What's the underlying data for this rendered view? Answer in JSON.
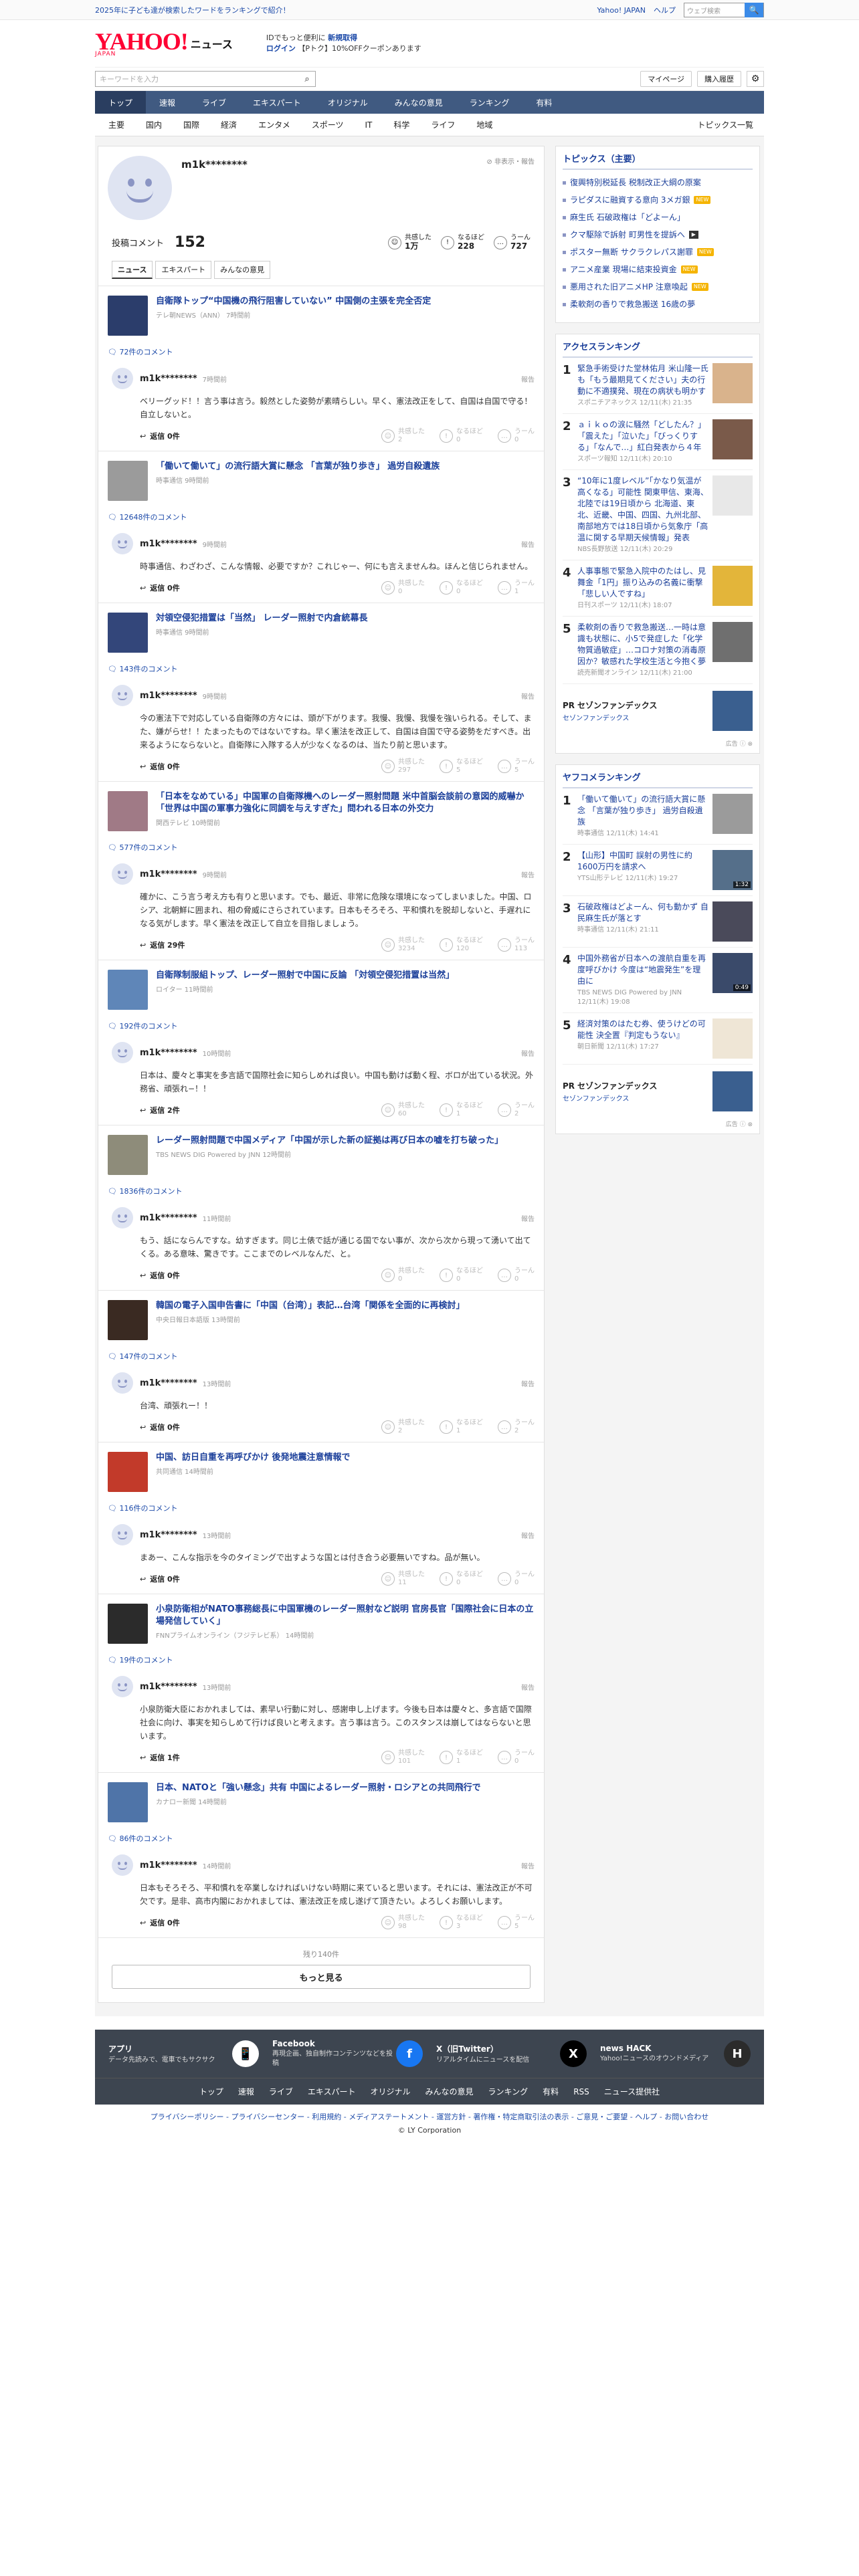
{
  "promo": {
    "text": "2025年に子ども達が検索したワードをランキングで紹介！",
    "yahoo_japan": "Yahoo! JAPAN",
    "help": "ヘルプ",
    "search_placeholder": "ウェブ検索",
    "search_btn": "🔍"
  },
  "masthead": {
    "logo": "YAHOO!",
    "logo_sub": "JAPAN",
    "news": "ニュース",
    "login_line1": "IDでもっと便利に",
    "login_line1_link": "新規取得",
    "login_line2_link": "ログイン",
    "login_line2_text": "【Pトク】10%OFFクーポンあります"
  },
  "search": {
    "placeholder": "キーワードを入力",
    "mypage": "マイページ",
    "history": "購入履歴"
  },
  "nav": [
    "トップ",
    "速報",
    "ライブ",
    "エキスパート",
    "オリジナル",
    "みんなの意見",
    "ランキング",
    "有料"
  ],
  "subnav": [
    "主要",
    "国内",
    "国際",
    "経済",
    "エンタメ",
    "スポーツ",
    "IT",
    "科学",
    "ライフ",
    "地域"
  ],
  "subnav_topics": "トピックス一覧",
  "profile": {
    "name": "m1k********",
    "report": "非表示・報告",
    "comment_label": "投稿コメント",
    "comment_count": "152",
    "reactions": [
      {
        "icon": "☺",
        "label": "共感した",
        "value": "1万"
      },
      {
        "icon": "!",
        "label": "なるほど",
        "value": "228"
      },
      {
        "icon": "…",
        "label": "うーん",
        "value": "727"
      }
    ],
    "tabs": [
      "ニュース",
      "エキスパート",
      "みんなの意見"
    ]
  },
  "entries": [
    {
      "title": "自衛隊トップ“中国機の飛行阻害していない” 中国側の主張を完全否定",
      "source": "テレ朝NEWS（ANN） 7時間前",
      "thumb": "#2b3d6b",
      "count": "72件のコメント",
      "time": "7時間前",
      "body": "ベリーグッド！！言う事は言う。毅然とした姿勢が素晴らしい。早く、憲法改正をして、自国は自国で守る！自立しないと。",
      "reply": "返信 0件",
      "votes": [
        "2",
        "0",
        "0"
      ]
    },
    {
      "title": "「働いて働いて」の流行語大賞に懸念 「言葉が独り歩き」 過労自殺遺族",
      "source": "時事通信 9時間前",
      "thumb": "#9b9b9b",
      "count": "12648件のコメント",
      "time": "9時間前",
      "body": "時事通信、わざわざ、こんな情報、必要ですか？これじゃー、何にも言えませんね。ほんと信じられません。",
      "reply": "返信 0件",
      "votes": [
        "0",
        "0",
        "1"
      ]
    },
    {
      "title": "対領空侵犯措置は「当然」 レーダー照射で内倉統幕長",
      "source": "時事通信 9時間前",
      "thumb": "#33467a",
      "count": "143件のコメント",
      "time": "9時間前",
      "body": "今の憲法下で対応している自衛隊の方々には、頭が下がります。我慢、我慢、我慢を強いられる。そして、また、嫌がらせ！！たまったものではないですね。早く憲法を改正して、自国は自国で守る姿勢をだすべき。出来るようにならないと。自衛隊に入隊する人が少なくなるのは、当たり前と思います。",
      "reply": "返信 0件",
      "votes": [
        "297",
        "5",
        "5"
      ]
    },
    {
      "title": "「日本をなめている」中国軍の自衛隊機へのレーダー照射問題 米中首脳会談前の意図的威嚇か「世界は中国の軍事力強化に同調を与えすぎた」問われる日本の外交力",
      "source": "関西テレビ 10時間前",
      "thumb": "#a07a86",
      "count": "577件のコメント",
      "time": "9時間前",
      "body": "確かに、こう言う考え方も有りと思います。でも、最近、非常に危険な環境になってしまいました。中国、ロシア、北朝鮮に囲まれ、相の脅威にさらされています。日本もそろそろ、平和慣れを脱却しないと、手遅れになる気がします。早く憲法を改正して自立を目指しましょう。",
      "reply": "返信 29件",
      "votes": [
        "3234",
        "120",
        "113"
      ]
    },
    {
      "title": "自衛隊制服組トップ、レーダー照射で中国に反論 「対領空侵犯措置は当然」",
      "source": "ロイター 11時間前",
      "thumb": "#5f86b8",
      "count": "192件のコメント",
      "time": "10時間前",
      "body": "日本は、慶々と事実を多言語で国際社会に知らしめれば良い。中国も動けば動く程、ボロが出ている状況。外務省、頑張れ−！！",
      "reply": "返信 2件",
      "votes": [
        "60",
        "1",
        "2"
      ]
    },
    {
      "title": "レーダー照射問題で中国メディア「中国が示した新の証拠は再び日本の嘘を打ち破った」",
      "source": "TBS NEWS DIG Powered by JNN 12時間前",
      "thumb": "#8e8c7a",
      "count": "1836件のコメント",
      "time": "11時間前",
      "body": "もう、話にならんですな。幼すぎます。同じ土俵で話が通じる国でない事が、次から次から現って湧いて出てくる。ある意味、驚きです。ここまでのレベルなんだ、と。",
      "reply": "返信 0件",
      "votes": [
        "0",
        "0",
        "0"
      ]
    },
    {
      "title": "韓国の電子入国申告書に「中国（台湾）」表記…台湾「関係を全面的に再検討」",
      "source": "中央日報日本語版 13時間前",
      "thumb": "#3a2a22",
      "count": "147件のコメント",
      "time": "13時間前",
      "body": "台湾、頑張れー！！",
      "reply": "返信 0件",
      "votes": [
        "2",
        "1",
        "2"
      ]
    },
    {
      "title": "中国、訪日自重を再呼びかけ 後発地震注意情報で",
      "source": "共同通信 14時間前",
      "thumb": "#c23a2a",
      "count": "116件のコメント",
      "time": "13時間前",
      "body": "まあー、こんな指示を今のタイミングで出すような国とは付き合う必要無いですね。品が無い。",
      "reply": "返信 0件",
      "votes": [
        "11",
        "0",
        "0"
      ]
    },
    {
      "title": "小泉防衛相がNATO事務総長に中国軍機のレーダー照射など説明 官房長官「国際社会に日本の立場発信していく」",
      "source": "FNNプライムオンライン（フジテレビ系） 14時間前",
      "thumb": "#2b2b2b",
      "count": "19件のコメント",
      "time": "13時間前",
      "body": "小泉防衛大臣におかれましては、素早い行動に対し、感謝申し上げます。今後も日本は慶々と、多言語で国際社会に向け、事実を知らしめて行けば良いと考えます。言う事は言う。このスタンスは崩してはならないと思います。",
      "reply": "返信 1件",
      "votes": [
        "101",
        "1",
        "0"
      ]
    },
    {
      "title": "日本、NATOと「強い懸念」共有 中国によるレーダー照射・ロシアとの共同飛行で",
      "source": "カナロー新聞 14時間前",
      "thumb": "#4f74a8",
      "count": "86件のコメント",
      "time": "14時間前",
      "body": "日本もそろそろ、平和慣れを卒業しなければいけない時期に来ていると思います。それには、憲法改正が不可欠です。是非、高市内閣におかれましては、憲法改正を成し遂げて頂きたい。よろしくお願いします。",
      "reply": "返信 0件",
      "votes": [
        "98",
        "3",
        "5"
      ]
    }
  ],
  "vote_labels": [
    "共感した",
    "なるほど",
    "うーん"
  ],
  "more": {
    "remaining": "残り140件",
    "button": "もっと見る"
  },
  "side": {
    "topics_title": "トピックス（主要）",
    "topics": [
      {
        "text": "復興特別税延長 税制改正大綱の原案",
        "badge": ""
      },
      {
        "text": "ラピダスに融資する意向 3メガ銀",
        "badge": "NEW"
      },
      {
        "text": "麻生氏 石破政権は「どよーん」",
        "badge": ""
      },
      {
        "text": "クマ駆除で訴射 町男性を提訴へ",
        "badge": "VIDEO"
      },
      {
        "text": "ポスター無断 サクラクレパス謝罪",
        "badge": "NEW"
      },
      {
        "text": "アニメ産業 現場に結束投資金",
        "badge": "NEW"
      },
      {
        "text": "悪用された旧アニメHP 注意喚起",
        "badge": "NEW"
      },
      {
        "text": "柔軟剤の香りで救急搬送 16歳の夢",
        "badge": ""
      }
    ],
    "access_title": "アクセスランキング",
    "access": [
      {
        "n": "1",
        "title": "緊急手術受けた堂林佑月 米山隆一氏も「もう最期見てください」夫の行動に不適撲発、現在の病状も明かす",
        "src": "スポニチアネックス 12/11(木) 21:35",
        "thumb": "#d9b38c"
      },
      {
        "n": "2",
        "title": "ａｉｋｏの涙に騒然「どしたん？」「震えた」「泣いた」「びっくりする」「なんで…」紅白発表から４年",
        "src": "スポーツ報知 12/11(木) 20:10",
        "thumb": "#7a5a4a"
      },
      {
        "n": "3",
        "title": "“10年に1度レベル”「かなり気温が高くなる」可能性 関東甲信、東海、北陸では19日頃から 北海道、東北、近畿、中国、四国、九州北部、南部地方では18日頃から気象庁「高温に関する早期天候情報」発表",
        "src": "NBS長野放送 12/11(木) 20:29",
        "thumb": "#e8e8e8"
      },
      {
        "n": "4",
        "title": "人事事態で緊急入院中のたはし、見舞金「1円」振り込みの名義に衝撃「悲しい人ですね」",
        "src": "日刊スポーツ 12/11(木) 18:07",
        "thumb": "#e3b53a"
      },
      {
        "n": "5",
        "title": "柔軟剤の香りで救急搬送…一時は意識も状態に、小5で発症した「化学物質過敏症」…コロナ対策の消毒原因か？敏感れた学校生活と今抱く夢",
        "src": "読売新聞オンライン 12/11(木) 21:00",
        "thumb": "#6f6f6f"
      }
    ],
    "pr1": {
      "label": "PR",
      "title": "セゾンファンデックス",
      "sub": "セゾンファンデックス",
      "ad": "広告 ⓘ ⊗"
    },
    "yako_title": "ヤフコメランキング",
    "yako": [
      {
        "n": "1",
        "title": "「働いて働いて」の流行語大賞に懸念 「言葉が独り歩き」 過労自殺遺族",
        "src": "時事通信 12/11(木) 14:41",
        "thumb": "#9b9b9b",
        "dur": ""
      },
      {
        "n": "2",
        "title": "【山形】中国町 誤射の男性に約1600万円を請求へ",
        "src": "YTS山形テレビ 12/11(木) 19:27",
        "thumb": "#556f8a",
        "dur": "1:32"
      },
      {
        "n": "3",
        "title": "石破政権はどよーん、何も動かず 自民麻生氏が落とす",
        "src": "時事通信 12/11(木) 21:11",
        "thumb": "#4a4a5a",
        "dur": ""
      },
      {
        "n": "4",
        "title": "中国外務省が日本への渡航自重を再度呼びかけ 今度は“地震発生”を理由に",
        "src": "TBS NEWS DIG Powered by JNN 12/11(木) 19:08",
        "thumb": "#3a4a6a",
        "dur": "0:49"
      },
      {
        "n": "5",
        "title": "経済対策のはたむ券、使うけどの可能性 決全置『判定もうない』",
        "src": "朝日新聞 12/11(木) 17:27",
        "thumb": "#efe6d6",
        "dur": ""
      }
    ],
    "pr2": {
      "label": "PR",
      "title": "セゾンファンデックス",
      "sub": "セゾンファンデックス",
      "ad": "広告 ⓘ ⊗"
    }
  },
  "footer": {
    "cards": [
      {
        "title": "アプリ",
        "desc": "データ先読みで、電車でもサクサク",
        "icon": "📱"
      },
      {
        "title": "Facebook",
        "desc": "再現企画、独自制作コンテンツなどを投稿",
        "icon": "f"
      },
      {
        "title": "X（旧Twitter）",
        "desc": "リアルタイムにニュースを配信",
        "icon": "X"
      },
      {
        "title": "news HACK",
        "desc": "Yahoo!ニュースのオウンドメディア",
        "icon": "H"
      }
    ],
    "nav": [
      "トップ",
      "速報",
      "ライブ",
      "エキスパート",
      "オリジナル",
      "みんなの意見",
      "ランキング",
      "有料",
      "RSS",
      "ニュース提供社"
    ],
    "links": "プライバシーポリシー - プライバシーセンター - 利用規約 - メディアステートメント - 運営方針 - 著作権・特定商取引法の表示 - ご意見・ご要望 - ヘルプ - お問い合わせ",
    "copyright": "© LY Corporation"
  },
  "colors": {
    "accent": "#405a81",
    "link": "#1b3f9a",
    "logo": "#ff0033"
  }
}
